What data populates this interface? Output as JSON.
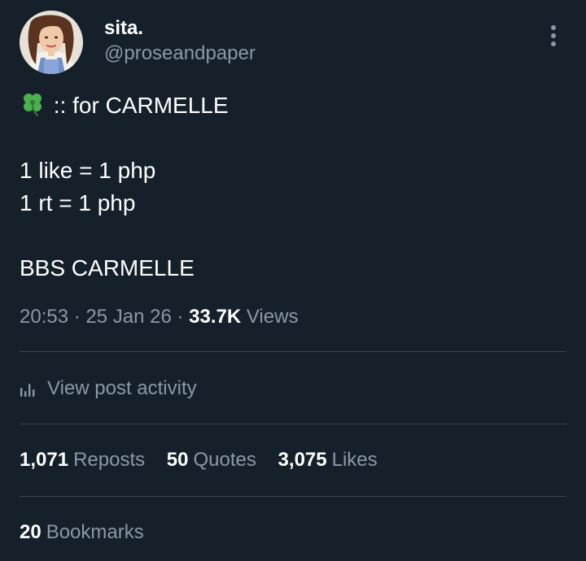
{
  "author": {
    "display_name": "sita.",
    "handle": "@proseandpaper"
  },
  "post": {
    "line1_emoji": "four-leaf-clover",
    "line1_text": " :: for CARMELLE",
    "line2": "1 like = 1 php",
    "line3": "1 rt = 1 php",
    "line4": "BBS CARMELLE"
  },
  "meta": {
    "time": "20:53",
    "sep1": " · ",
    "date": "25 Jan 26",
    "sep2": " · ",
    "views_count": "33.7K",
    "views_label": " Views"
  },
  "activity": {
    "label": "View post activity",
    "icon": "bar-chart-icon"
  },
  "stats": {
    "reposts_count": "1,071",
    "reposts_label": "Reposts",
    "quotes_count": "50",
    "quotes_label": "Quotes",
    "likes_count": "3,075",
    "likes_label": "Likes",
    "bookmarks_count": "20",
    "bookmarks_label": "Bookmarks"
  },
  "colors": {
    "background": "#15202b",
    "text_primary": "#ffffff",
    "text_secondary": "#8b98a5",
    "divider": "#38444d",
    "clover": "#4caf50"
  }
}
